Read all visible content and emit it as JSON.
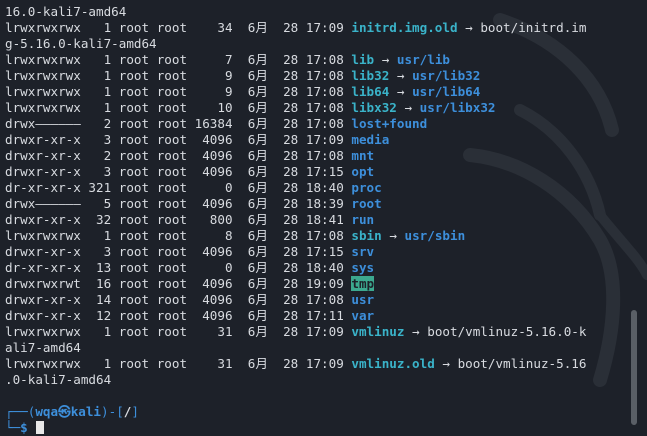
{
  "terminal": {
    "lines": [
      {
        "type": "wrap",
        "text": "16.0-kali7-amd64"
      },
      {
        "type": "entry",
        "perms": "lrwxrwxrwx",
        "links": "1",
        "owner": "root",
        "group": "root",
        "size": "34",
        "month": "6月",
        "day": "28",
        "time": "17:09",
        "name": "initrd.img.old",
        "kind": "link",
        "target": "boot/initrd.im",
        "tgtkind": "plain"
      },
      {
        "type": "wrap",
        "text": "g-5.16.0-kali7-amd64"
      },
      {
        "type": "entry",
        "perms": "lrwxrwxrwx",
        "links": "1",
        "owner": "root",
        "group": "root",
        "size": "7",
        "month": "6月",
        "day": "28",
        "time": "17:08",
        "name": "lib",
        "kind": "link",
        "target": "usr/lib",
        "tgtkind": "dir"
      },
      {
        "type": "entry",
        "perms": "lrwxrwxrwx",
        "links": "1",
        "owner": "root",
        "group": "root",
        "size": "9",
        "month": "6月",
        "day": "28",
        "time": "17:08",
        "name": "lib32",
        "kind": "link",
        "target": "usr/lib32",
        "tgtkind": "dir"
      },
      {
        "type": "entry",
        "perms": "lrwxrwxrwx",
        "links": "1",
        "owner": "root",
        "group": "root",
        "size": "9",
        "month": "6月",
        "day": "28",
        "time": "17:08",
        "name": "lib64",
        "kind": "link",
        "target": "usr/lib64",
        "tgtkind": "dir"
      },
      {
        "type": "entry",
        "perms": "lrwxrwxrwx",
        "links": "1",
        "owner": "root",
        "group": "root",
        "size": "10",
        "month": "6月",
        "day": "28",
        "time": "17:08",
        "name": "libx32",
        "kind": "link",
        "target": "usr/libx32",
        "tgtkind": "dir"
      },
      {
        "type": "entry",
        "perms": "drwx——————",
        "links": "2",
        "owner": "root",
        "group": "root",
        "size": "16384",
        "month": "6月",
        "day": "28",
        "time": "17:08",
        "name": "lost+found",
        "kind": "dir"
      },
      {
        "type": "entry",
        "perms": "drwxr-xr-x",
        "links": "3",
        "owner": "root",
        "group": "root",
        "size": "4096",
        "month": "6月",
        "day": "28",
        "time": "17:09",
        "name": "media",
        "kind": "dir"
      },
      {
        "type": "entry",
        "perms": "drwxr-xr-x",
        "links": "2",
        "owner": "root",
        "group": "root",
        "size": "4096",
        "month": "6月",
        "day": "28",
        "time": "17:08",
        "name": "mnt",
        "kind": "dir"
      },
      {
        "type": "entry",
        "perms": "drwxr-xr-x",
        "links": "3",
        "owner": "root",
        "group": "root",
        "size": "4096",
        "month": "6月",
        "day": "28",
        "time": "17:15",
        "name": "opt",
        "kind": "dir"
      },
      {
        "type": "entry",
        "perms": "dr-xr-xr-x",
        "links": "321",
        "owner": "root",
        "group": "root",
        "size": "0",
        "month": "6月",
        "day": "28",
        "time": "18:40",
        "name": "proc",
        "kind": "dir"
      },
      {
        "type": "entry",
        "perms": "drwx——————",
        "links": "5",
        "owner": "root",
        "group": "root",
        "size": "4096",
        "month": "6月",
        "day": "28",
        "time": "18:39",
        "name": "root",
        "kind": "dir"
      },
      {
        "type": "entry",
        "perms": "drwxr-xr-x",
        "links": "32",
        "owner": "root",
        "group": "root",
        "size": "800",
        "month": "6月",
        "day": "28",
        "time": "18:41",
        "name": "run",
        "kind": "dir"
      },
      {
        "type": "entry",
        "perms": "lrwxrwxrwx",
        "links": "1",
        "owner": "root",
        "group": "root",
        "size": "8",
        "month": "6月",
        "day": "28",
        "time": "17:08",
        "name": "sbin",
        "kind": "link",
        "target": "usr/sbin",
        "tgtkind": "dir"
      },
      {
        "type": "entry",
        "perms": "drwxr-xr-x",
        "links": "3",
        "owner": "root",
        "group": "root",
        "size": "4096",
        "month": "6月",
        "day": "28",
        "time": "17:15",
        "name": "srv",
        "kind": "dir"
      },
      {
        "type": "entry",
        "perms": "dr-xr-xr-x",
        "links": "13",
        "owner": "root",
        "group": "root",
        "size": "0",
        "month": "6月",
        "day": "28",
        "time": "18:40",
        "name": "sys",
        "kind": "dir"
      },
      {
        "type": "entry",
        "perms": "drwxrwxrwt",
        "links": "16",
        "owner": "root",
        "group": "root",
        "size": "4096",
        "month": "6月",
        "day": "28",
        "time": "19:09",
        "name": "tmp",
        "kind": "tmp"
      },
      {
        "type": "entry",
        "perms": "drwxr-xr-x",
        "links": "14",
        "owner": "root",
        "group": "root",
        "size": "4096",
        "month": "6月",
        "day": "28",
        "time": "17:08",
        "name": "usr",
        "kind": "dir"
      },
      {
        "type": "entry",
        "perms": "drwxr-xr-x",
        "links": "12",
        "owner": "root",
        "group": "root",
        "size": "4096",
        "month": "6月",
        "day": "28",
        "time": "17:11",
        "name": "var",
        "kind": "dir"
      },
      {
        "type": "entry",
        "perms": "lrwxrwxrwx",
        "links": "1",
        "owner": "root",
        "group": "root",
        "size": "31",
        "month": "6月",
        "day": "28",
        "time": "17:09",
        "name": "vmlinuz",
        "kind": "link",
        "target": "boot/vmlinuz-5.16.0-k",
        "tgtkind": "plain"
      },
      {
        "type": "wrap",
        "text": "ali7-amd64"
      },
      {
        "type": "entry",
        "perms": "lrwxrwxrwx",
        "links": "1",
        "owner": "root",
        "group": "root",
        "size": "31",
        "month": "6月",
        "day": "28",
        "time": "17:09",
        "name": "vmlinuz.old",
        "kind": "link",
        "target": "boot/vmlinuz-5.16",
        "tgtkind": "plain"
      },
      {
        "type": "wrap",
        "text": ".0-kali7-amd64"
      },
      {
        "type": "blank",
        "text": ""
      }
    ],
    "arrow": "→",
    "prompt": {
      "top_left": "┌──(",
      "user": "wqa",
      "at_symbol": "㉿",
      "host": "kali",
      "mid": ")-[",
      "cwd": "/",
      "close": "]",
      "bottom_left": "└─",
      "symbol": "$"
    }
  },
  "scrollbar": {
    "position_fraction": 0.92
  },
  "colors": {
    "background": "#1d2129",
    "directory": "#3d8fdb",
    "symlink": "#3ab3c9",
    "sticky_bg": "#3ca98f",
    "text": "#d8dbe0"
  }
}
